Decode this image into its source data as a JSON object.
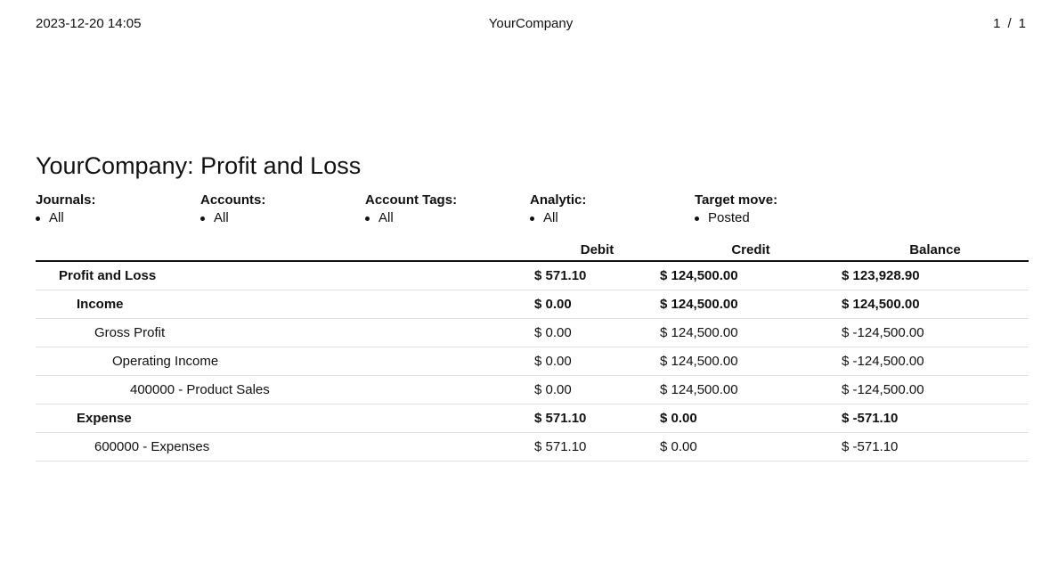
{
  "header": {
    "datetime": "2023-12-20 14:05",
    "company": "YourCompany",
    "page_current": "1",
    "page_separator": "/",
    "page_total": "1"
  },
  "report": {
    "title": "YourCompany: Profit and Loss"
  },
  "filters": [
    {
      "label": "Journals:",
      "value": "All"
    },
    {
      "label": "Accounts:",
      "value": "All"
    },
    {
      "label": "Account Tags:",
      "value": "All"
    },
    {
      "label": "Analytic:",
      "value": "All"
    },
    {
      "label": "Target move:",
      "value": "Posted"
    }
  ],
  "table": {
    "columns": {
      "name": "",
      "debit": "Debit",
      "credit": "Credit",
      "balance": "Balance"
    },
    "rows": [
      {
        "name": "Profit and Loss",
        "level": 1,
        "bold": true,
        "debit": "$ 571.10",
        "credit": "$ 124,500.00",
        "balance": "$ 123,928.90"
      },
      {
        "name": "Income",
        "level": 2,
        "bold": true,
        "debit": "$ 0.00",
        "credit": "$ 124,500.00",
        "balance": "$ 124,500.00"
      },
      {
        "name": "Gross Profit",
        "level": 3,
        "bold": false,
        "debit": "$ 0.00",
        "credit": "$ 124,500.00",
        "balance": "$ -124,500.00"
      },
      {
        "name": "Operating Income",
        "level": 4,
        "bold": false,
        "debit": "$ 0.00",
        "credit": "$ 124,500.00",
        "balance": "$ -124,500.00"
      },
      {
        "name": "400000 - Product Sales",
        "level": 5,
        "bold": false,
        "debit": "$ 0.00",
        "credit": "$ 124,500.00",
        "balance": "$ -124,500.00"
      },
      {
        "name": "Expense",
        "level": 2,
        "bold": true,
        "debit": "$ 571.10",
        "credit": "$ 0.00",
        "balance": "$ -571.10"
      },
      {
        "name": "600000 - Expenses",
        "level": 3,
        "bold": false,
        "debit": "$ 571.10",
        "credit": "$ 0.00",
        "balance": "$ -571.10"
      }
    ]
  }
}
